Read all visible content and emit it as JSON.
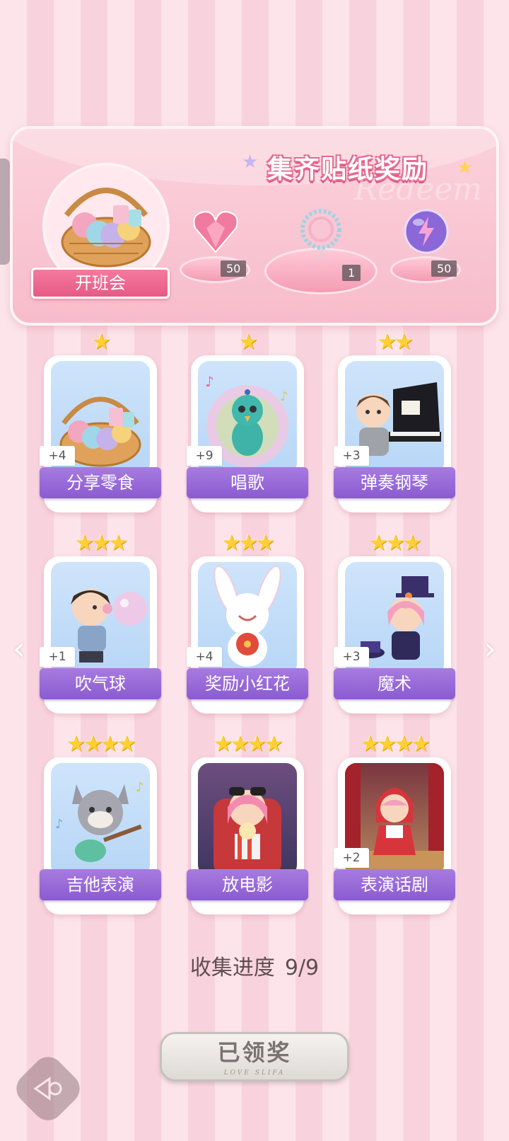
{
  "banner": {
    "title": "集齐贴纸奖励",
    "watermark": "Redeem",
    "class_label": "开班会",
    "rewards": [
      {
        "icon": "heart-gem-icon",
        "count": "50"
      },
      {
        "icon": "bracelet-icon",
        "count": "1"
      },
      {
        "icon": "energy-orb-icon",
        "count": "50"
      }
    ]
  },
  "cards": [
    {
      "label": "分享零食",
      "stars": "★",
      "plus": "+4",
      "icon": "snack-basket-icon"
    },
    {
      "label": "唱歌",
      "stars": "★",
      "plus": "+9",
      "icon": "singing-peacock-icon"
    },
    {
      "label": "弹奏钢琴",
      "stars": "★★",
      "plus": "+3",
      "icon": "piano-boy-icon"
    },
    {
      "label": "吹气球",
      "stars": "★★★",
      "plus": "+1",
      "icon": "balloon-boy-icon"
    },
    {
      "label": "奖励小红花",
      "stars": "★★★",
      "plus": "+4",
      "icon": "bunny-flower-icon"
    },
    {
      "label": "魔术",
      "stars": "★★★",
      "plus": "+3",
      "icon": "magician-girl-icon"
    },
    {
      "label": "吉他表演",
      "stars": "★★★★",
      "plus": "",
      "icon": "guitar-wolf-icon"
    },
    {
      "label": "放电影",
      "stars": "★★★★",
      "plus": "",
      "icon": "popcorn-girl-icon"
    },
    {
      "label": "表演话剧",
      "stars": "★★★★",
      "plus": "+2",
      "icon": "red-hood-girl-icon"
    }
  ],
  "progress": {
    "label": "收集进度",
    "value": "9/9",
    "fraction": 1.0
  },
  "claim_button": {
    "label": "已领奖",
    "sub": "LOVE SLIFA"
  },
  "colors": {
    "accent_pink": "#e65a85",
    "label_purple": "#8b5bd0",
    "star_gold": "#ffcf33"
  }
}
